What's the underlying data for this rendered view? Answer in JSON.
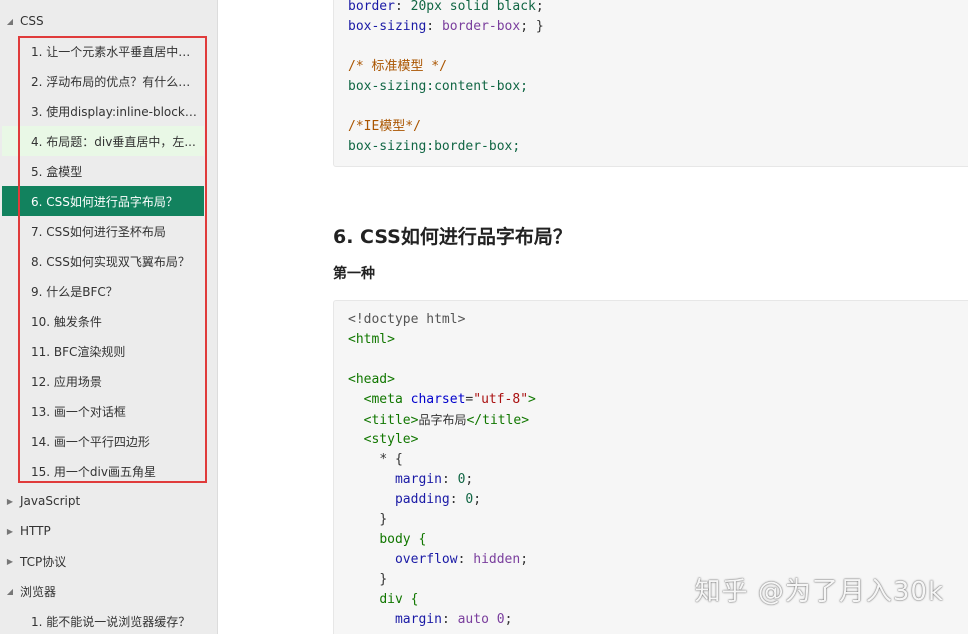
{
  "sidebar": {
    "sections": {
      "css": "CSS",
      "javascript": "JavaScript",
      "http": "HTTP",
      "tcp": "TCP协议",
      "browser": "浏览器"
    },
    "css_items": [
      "1. 让一个元素水平垂直居中，...",
      "2. 浮动布局的优点？有什么缺...",
      "3. 使用display:inline-block会...",
      "4. 布局题：div垂直居中，左...",
      "5. 盒模型",
      "6. CSS如何进行品字布局？",
      "7. CSS如何进行圣杯布局",
      "8. CSS如何实现双飞翼布局？",
      "9. 什么是BFC？",
      "10. 触发条件",
      "11. BFC渲染规则",
      "12. 应用场景",
      "13. 画一个对话框",
      "14. 画一个平行四边形",
      "15. 用一个div画五角星"
    ],
    "browser_items": [
      "1. 能不能说一说浏览器缓存？"
    ]
  },
  "content": {
    "heading": "6. CSS如何进行品字布局？",
    "subheading": "第一种",
    "code1": {
      "l1_prop": "border",
      "l1_val": "20px solid black",
      "l2_prop": "box-sizing",
      "l2_val": "border-box",
      "l3_comment": "/* 标准模型 */",
      "l4": "box-sizing:content-box;",
      "l5_comment": "/*IE模型*/",
      "l6": "box-sizing:border-box;"
    },
    "code2": {
      "doctype": "<!doctype html>",
      "html_open": "<html>",
      "head_open": "<head>",
      "meta_tag": "<meta",
      "meta_attr": "charset",
      "meta_val": "\"utf-8\"",
      "meta_close": ">",
      "title_open": "<title>",
      "title_text": "品字布局",
      "title_close": "</title>",
      "style_open": "<style>",
      "star_sel": "* {",
      "margin_prop": "margin",
      "margin_val": "0",
      "padding_prop": "padding",
      "padding_val": "0",
      "close_brace": "}",
      "body_sel": "body {",
      "overflow_prop": "overflow",
      "overflow_val": "hidden",
      "div_sel": "div {",
      "div_margin_prop": "margin",
      "div_margin_val": "auto 0"
    }
  },
  "watermark": "知乎 @为了月入30k",
  "colors": {
    "active_bg": "#12825e",
    "hover_bg": "#e9f8e6",
    "highlight_border": "#e03b3b"
  }
}
